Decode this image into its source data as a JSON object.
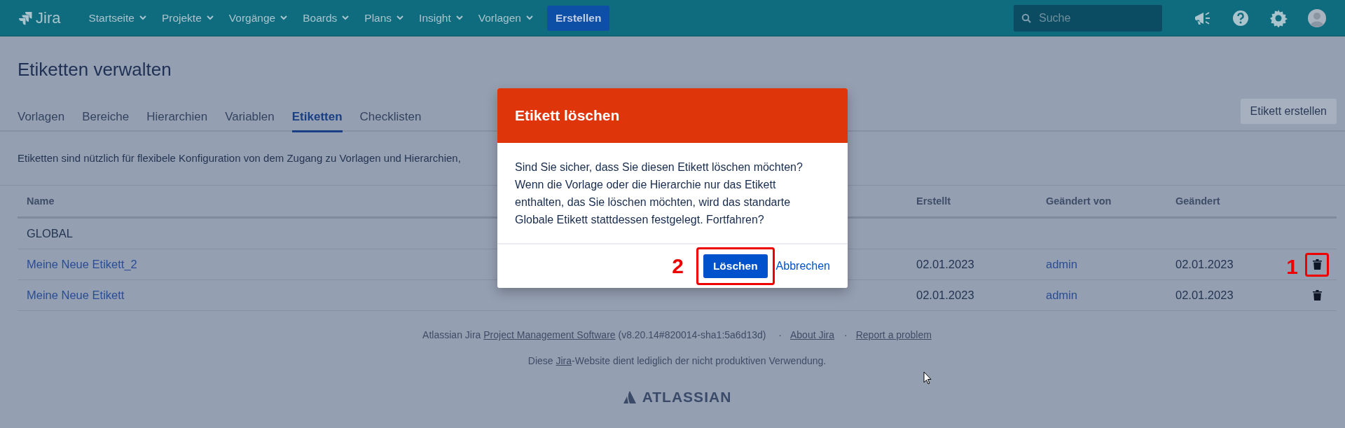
{
  "header": {
    "logo": "Jira",
    "nav": [
      {
        "label": "Startseite"
      },
      {
        "label": "Projekte"
      },
      {
        "label": "Vorgänge"
      },
      {
        "label": "Boards"
      },
      {
        "label": "Plans"
      },
      {
        "label": "Insight"
      },
      {
        "label": "Vorlagen"
      }
    ],
    "create_button": "Erstellen",
    "search": {
      "placeholder": "Suche"
    }
  },
  "page": {
    "title": "Etiketten verwalten",
    "tabs": [
      {
        "label": "Vorlagen",
        "selected": false
      },
      {
        "label": "Bereiche",
        "selected": false
      },
      {
        "label": "Hierarchien",
        "selected": false
      },
      {
        "label": "Variablen",
        "selected": false
      },
      {
        "label": "Etiketten",
        "selected": true
      },
      {
        "label": "Checklisten",
        "selected": false
      }
    ],
    "create_button": "Etikett erstellen",
    "description": "Etiketten sind nützlich für flexibele Konfiguration von dem Zugang zu Vorlagen und Hierarchien,"
  },
  "table": {
    "columns": [
      "Name",
      "Erstellt",
      "Geändert von",
      "Geändert"
    ],
    "rows": [
      {
        "kind": "group",
        "name": "GLOBAL"
      },
      {
        "kind": "label",
        "name": "Meine Neue Etikett_2",
        "created": "02.01.2023",
        "modified_by": "admin",
        "modified": "02.01.2023",
        "annotation": "1"
      },
      {
        "kind": "label",
        "name": "Meine Neue Etikett",
        "created": "02.01.2023",
        "modified_by": "admin",
        "modified": "02.01.2023"
      }
    ]
  },
  "dialog": {
    "title": "Etikett löschen",
    "message": "Sind Sie sicher, dass Sie diesen Etikett löschen möchten? Wenn die Vorlage oder die Hierarchie nur das Etikett enthalten, das Sie löschen möchten, wird das standarte Globale Etikett stattdessen festgelegt. Fortfahren?",
    "confirm_button": "Löschen",
    "cancel_link": "Abbrechen",
    "annotation": "2"
  },
  "footer": {
    "line_1": {
      "prefix": "Atlassian Jira",
      "link": "Project Management Software",
      "version": "(v8.20.14#820014-sha1:5a6d13d)",
      "links": [
        "About Jira",
        "Report a problem"
      ],
      "separator": "·"
    },
    "line_2": {
      "before": "Diese",
      "link": "Jira",
      "after": "-Website dient lediglich der nicht produktiven Verwendung."
    },
    "logo": "ATLASSIAN"
  }
}
